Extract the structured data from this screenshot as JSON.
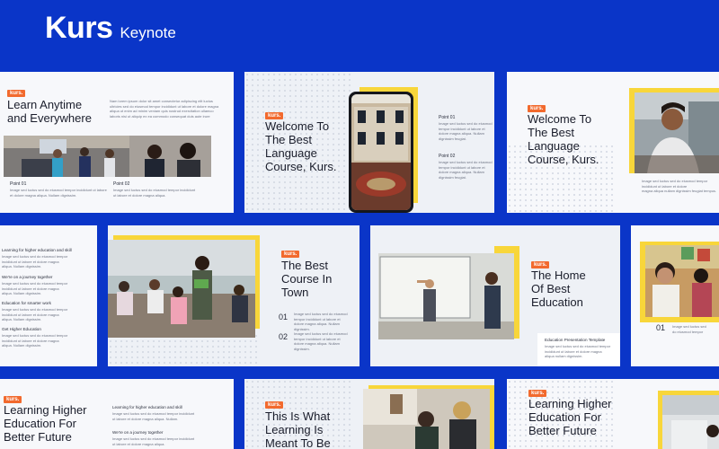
{
  "brand": {
    "name": "Kurs",
    "subtitle": "Keynote"
  },
  "colors": {
    "background": "#0a35c8",
    "accent": "#f8d63a",
    "tag": "#f26a2e"
  },
  "slides": {
    "s1": {
      "tag": "kurs.",
      "title": "Learn Anytime\nand Everywhere",
      "body": "Nam lorem ipsum dolor sit amet consectetur adipiscing elit luctus\nultricies sed do eiusmod tempor incididunt ut labore et dolore magna\naliqua ut enim ad minim veniam quis nostrud exercitation ullamco\nlaboris nisi ut aliquip ex ea commodo consequat duis aute irure",
      "point1_label": "Point 01",
      "point1_text": "Image sed luctus sed do eiusmod tempor incididunt ut labore\net dolore magna aliqua. Nullam dignissim.",
      "point2_label": "Point 02",
      "point2_text": "Image sed luctus sed do eiusmod tempor incididunt\nut labore et dolore magna aliqua."
    },
    "s2": {
      "tag": "kurs.",
      "title": "Welcome To\nThe Best\nLanguage\nCourse, Kurs.",
      "point1_label": "Point 01",
      "point1_text": "Image sed luctus sed do eiusmod\ntempor incididunt ut labore et\ndolore magna aliqua. Nullam\ndignissim feugiat.",
      "point2_label": "Point 02",
      "point2_text": "Image sed luctus sed do eiusmod\ntempor incididunt ut labore et\ndolore magna aliqua. Nullam\ndignissim feugiat."
    },
    "s3": {
      "tag": "kurs.",
      "title": "Welcome To\nThe Best\nLanguage\nCourse, Kurs.",
      "body": "Image sed luctus sed do eiusmod tempor incididunt ut labore et dolore\nmagna aliqua nullam dignissim feugiat tempus."
    },
    "s4": {
      "items": [
        {
          "label": "Learning for higher education and skill",
          "text": "Image sed luctus sed do eiusmod tempor\nincididunt ut labore et dolore magna\naliqua. Nullam dignissim."
        },
        {
          "label": "We're on a journey together",
          "text": "Image sed luctus sed do eiusmod tempor\nincididunt ut labore et dolore magna\naliqua. Nullam dignissim."
        },
        {
          "label": "Education for smarter work",
          "text": "Image sed luctus sed do eiusmod tempor\nincididunt ut labore et dolore magna\naliqua. Nullam dignissim."
        },
        {
          "label": "Get Higher Education",
          "text": "Image sed luctus sed do eiusmod tempor\nincididunt ut labore et dolore magna\naliqua. Nullam dignissim."
        }
      ]
    },
    "s5": {
      "tag": "kurs.",
      "title": "The Best\nCourse In\nTown",
      "point1_num": "01",
      "point1_text": "Image sed luctus sed do eiusmod\ntempor incididunt ut labore et\ndolore magna aliqua. Nullam\ndignissim.",
      "point2_num": "02",
      "point2_text": "Image sed luctus sed do eiusmod\ntempor incididunt ut labore et\ndolore magna aliqua. Nullam\ndignissim."
    },
    "s6": {
      "tag": "kurs.",
      "title": "The Home\nOf Best\nEducation",
      "footer_label": "Education Presentation Template",
      "footer_text": "Image sed luctus sed do eiusmod tempor\nincididunt ut labore et dolore magna\naliqua nullam dignissim."
    },
    "s7": {
      "point1_num": "01",
      "point1_text": "Image sed luctus sed\ndo eiusmod tempor"
    },
    "s8": {
      "tag": "kurs.",
      "title": "Learning Higher\nEducation For\nBetter Future",
      "item1_label": "Learning for higher education and skill",
      "item1_text": "Image sed luctus sed do eiusmod tempor incididunt\nut labore et dolore magna aliqua. Nullam.",
      "item2_label": "We're on a journey together",
      "item2_text": "Image sed luctus sed do eiusmod tempor incididunt\nut labore et dolore magna aliqua."
    },
    "s9": {
      "tag": "kurs.",
      "title": "This Is What\nLearning Is\nMeant To Be"
    },
    "s10": {
      "tag": "kurs.",
      "title": "Learning Higher\nEducation For\nBetter Future"
    }
  }
}
